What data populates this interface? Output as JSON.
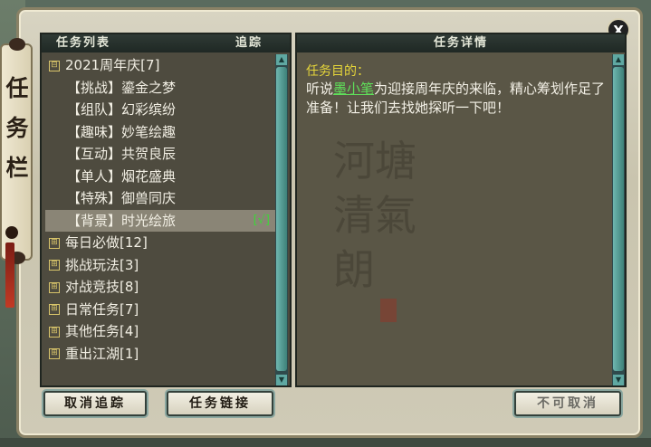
{
  "window": {
    "side_title": "任务栏",
    "close_label": "X"
  },
  "left_panel": {
    "title": "任务列表",
    "track_label": "追踪",
    "groups": [
      {
        "sign": "⊟",
        "label": "2021周年庆[7]",
        "expanded": true,
        "items": [
          {
            "label": "【挑战】鎏金之梦",
            "selected": false
          },
          {
            "label": "【组队】幻彩缤纷",
            "selected": false
          },
          {
            "label": "【趣味】妙笔绘趣",
            "selected": false
          },
          {
            "label": "【互动】共贺良辰",
            "selected": false
          },
          {
            "label": "【单人】烟花盛典",
            "selected": false
          },
          {
            "label": "【特殊】御兽同庆",
            "selected": false
          },
          {
            "label": "【背景】时光绘旅",
            "selected": true,
            "tracked": "[√]"
          }
        ]
      },
      {
        "sign": "⊞",
        "label": "每日必做[12]"
      },
      {
        "sign": "⊞",
        "label": "挑战玩法[3]"
      },
      {
        "sign": "⊞",
        "label": "对战竞技[8]"
      },
      {
        "sign": "⊞",
        "label": "日常任务[7]"
      },
      {
        "sign": "⊞",
        "label": "其他任务[4]"
      },
      {
        "sign": "⊞",
        "label": "重出江湖[1]"
      }
    ]
  },
  "right_panel": {
    "title": "任务详情",
    "objective_label": "任务目的：",
    "text_before": "听说",
    "npc_name": "墨小笔",
    "text_after": "为迎接周年庆的来临，精心筹划作足了准备！让我们去找她探听一下吧！"
  },
  "buttons": {
    "cancel_track": "取消追踪",
    "task_link": "任务链接",
    "cannot_cancel": "不可取消"
  },
  "colors": {
    "objective": "#e6d63a",
    "npc_link": "#5fe05a",
    "track_check": "#3fd43a"
  }
}
